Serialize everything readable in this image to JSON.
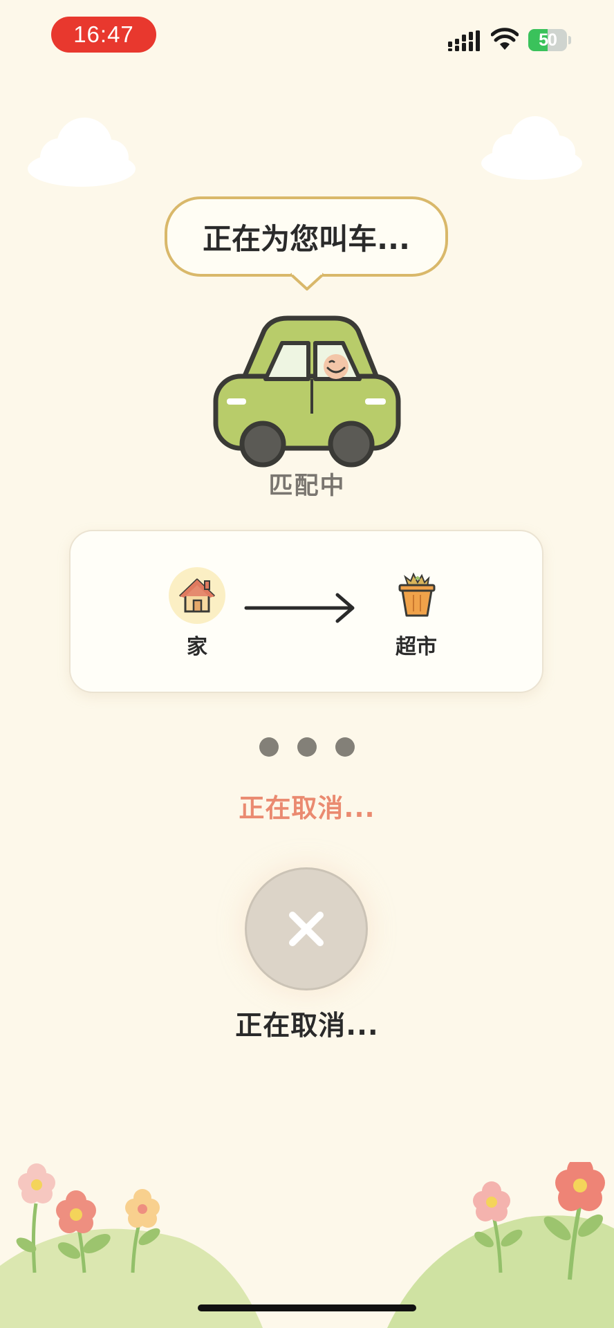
{
  "status_bar": {
    "time": "16:47",
    "battery_level": "50",
    "battery_fraction": 0.5,
    "icons": [
      "signal-icon",
      "wifi-icon",
      "battery-icon"
    ]
  },
  "hero": {
    "bubble_text": "正在为您叫车...",
    "status_label": "匹配中"
  },
  "route": {
    "origin": {
      "label": "家",
      "icon": "house-icon"
    },
    "destination": {
      "label": "超市",
      "icon": "grocery-basket-icon"
    },
    "arrow_icon": "right-arrow-icon"
  },
  "progress_dots": 3,
  "cancel": {
    "status_text": "正在取消...",
    "button_icon": "close-icon",
    "caption": "正在取消..."
  },
  "colors": {
    "background": "#fdf8ea",
    "accent_red": "#e8382e",
    "cancel_text": "#ea8a70",
    "car_green": "#b8cc6a",
    "bubble_border": "#d9b86a"
  }
}
